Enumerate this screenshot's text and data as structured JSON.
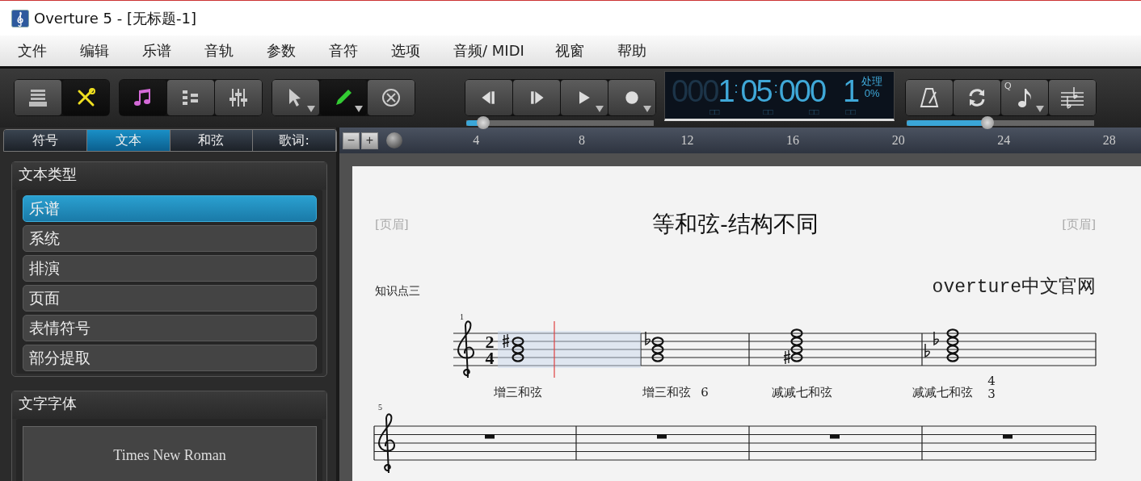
{
  "window": {
    "title": "Overture 5 - [无标题-1]"
  },
  "menu": [
    "文件",
    "编辑",
    "乐谱",
    "音轨",
    "参数",
    "音符",
    "选项",
    "音频/ MIDI",
    "视窗",
    "帮助"
  ],
  "toolbar": {
    "groups": [
      {
        "buttons": [
          {
            "pressed": false
          },
          {
            "pressed": true
          }
        ]
      },
      {
        "buttons": [
          {
            "pressed": true
          },
          {
            "pressed": false
          },
          {
            "pressed": false
          }
        ]
      },
      {
        "buttons": [
          {
            "pressed": false
          },
          {
            "pressed": true
          },
          {
            "pressed": false
          }
        ]
      }
    ]
  },
  "transport": {
    "buttons": [
      {
        "pressed": false
      },
      {
        "pressed": false
      },
      {
        "pressed": false
      },
      {
        "pressed": false
      }
    ],
    "level": 0.09
  },
  "display": {
    "fields": [
      {
        "dim": "000",
        "value": "1",
        "separator": ":",
        "caption": "□□"
      },
      {
        "value": "05",
        "separator": ":",
        "caption": "□□"
      },
      {
        "value": "000",
        "caption": "□□"
      },
      {
        "value": "1",
        "caption": "□□"
      }
    ],
    "status": "处理",
    "percent": "0%"
  },
  "tools": {
    "buttons": [
      {
        "pressed": false
      },
      {
        "pressed": false
      },
      {
        "pressed": false,
        "label": "Q"
      },
      {
        "pressed": false
      }
    ],
    "level": 0.43
  },
  "palette": {
    "tabs": [
      {
        "label": "符号",
        "selected": false
      },
      {
        "label": "文本",
        "selected": true
      },
      {
        "label": "和弦",
        "selected": false
      },
      {
        "label": "歌词:",
        "selected": false
      }
    ],
    "text_type": {
      "title": "文本类型",
      "items": [
        {
          "label": "乐谱",
          "selected": true
        },
        {
          "label": "系统",
          "selected": false
        },
        {
          "label": "排演",
          "selected": false
        },
        {
          "label": "页面",
          "selected": false
        },
        {
          "label": "表情符号",
          "selected": false
        },
        {
          "label": "部分提取",
          "selected": false
        }
      ]
    },
    "font": {
      "title": "文字字体",
      "value": "Times New Roman"
    }
  },
  "ruler": {
    "buttons": [
      "−",
      "+"
    ],
    "ticks": [
      "4",
      "8",
      "12",
      "16",
      "20",
      "24",
      "28"
    ]
  },
  "score": {
    "header_left": "[页眉]",
    "title": "等和弦-结构不同",
    "header_right": "[页眉]",
    "subtitle": "知识点三",
    "credit": "overture中文官网",
    "systems": [
      {
        "number": "1",
        "time_signature": [
          "2",
          "4"
        ],
        "chords": [
          {
            "label": "增三和弦"
          },
          {
            "label": "增三和弦",
            "figures": [
              "6"
            ]
          },
          {
            "label": "减减七和弦"
          },
          {
            "label": "减减七和弦",
            "figures": [
              "4",
              "3"
            ]
          }
        ]
      },
      {
        "number": "5"
      }
    ]
  }
}
